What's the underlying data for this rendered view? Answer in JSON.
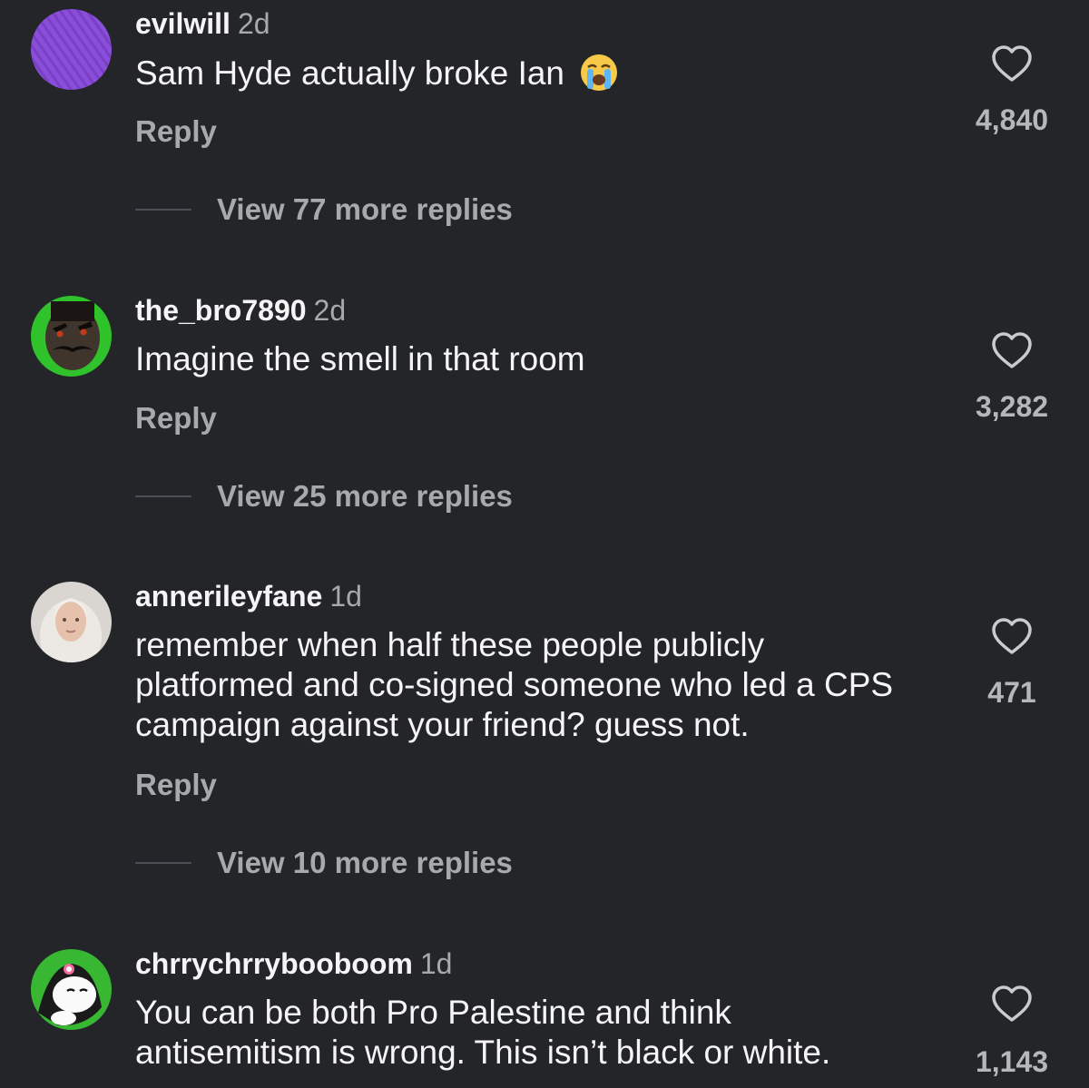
{
  "comments": [
    {
      "username": "evilwill",
      "time": "2d",
      "text": "Sam Hyde actually broke Ian",
      "emoji": "loudly-crying-face",
      "reply_label": "Reply",
      "likes": "4,840",
      "view_more": "View 77 more replies"
    },
    {
      "username": "the_bro7890",
      "time": "2d",
      "text": "Imagine the smell in that room",
      "reply_label": "Reply",
      "likes": "3,282",
      "view_more": "View 25 more replies"
    },
    {
      "username": "annerileyfane",
      "time": "1d",
      "text": "remember when half these people publicly platformed and co-signed someone who led a CPS campaign against your friend? guess not.",
      "reply_label": "Reply",
      "likes": "471",
      "view_more": "View 10 more replies"
    },
    {
      "username": "chrrychrrybooboom",
      "time": "1d",
      "text": "You can be both Pro Palestine and think antisemitism is wrong. This isn’t black or white.",
      "likes": "1,143"
    }
  ],
  "colors": {
    "background": "#232529",
    "primary_text": "#f5f5f5",
    "secondary_text": "#a7a9ad",
    "avatar_purple": "#8a4fd8",
    "avatar_green": "#2fc22a"
  },
  "icons": {
    "like": "heart-outline-icon",
    "emoji": "loudly-crying-face-emoji"
  }
}
